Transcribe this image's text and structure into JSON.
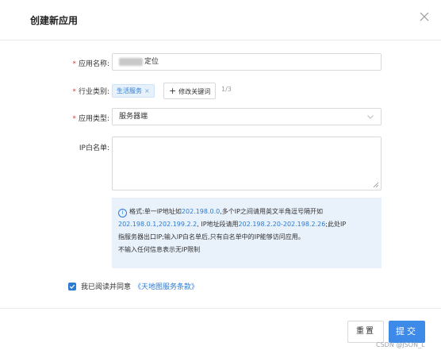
{
  "dialog": {
    "title": "创建新应用",
    "close_icon": "close-icon"
  },
  "form": {
    "app_name": {
      "label": "应用名称:",
      "value": "定位",
      "blurred_prefix": true
    },
    "industry": {
      "label": "行业类别:",
      "tag": "生活服务",
      "tag_remove": "×",
      "edit_button": "修改关键词",
      "edit_icon": "+",
      "count": "1/3"
    },
    "app_type": {
      "label": "应用类型:",
      "value": "服务器端",
      "chevron_icon": "chevron-down-icon"
    },
    "ip_whitelist": {
      "label": "IP白名单:",
      "value": ""
    },
    "hint": {
      "icon": "i",
      "line1_a": "格式:单一IP地址如",
      "line1_ip": "202.198.0.0",
      "line1_b": ",多个IP之间请用英文半角逗号隔开如",
      "line2_ip": "202.198.0.1,202.199.2.2",
      "line2_b": ", IP地址段请用",
      "line2_ip2": "202.198.2.20-202.198.2.26",
      "line2_c": ";此处IP",
      "line3": "指服务器出口IP;输入IP白名单后,只有白名单中的IP能够访问应用。",
      "line4": "不输入任何信息表示无IP限制"
    }
  },
  "agreement": {
    "checked": true,
    "text": "我已阅读并同意",
    "link": "《天地图服务条款》"
  },
  "footer": {
    "reset": "重置",
    "submit": "提交"
  },
  "watermark": "CSDN @JSON_L",
  "colors": {
    "primary": "#3d8ae8",
    "link": "#2b7bd4",
    "required": "#e4393c",
    "hint_bg": "#e9f1fb"
  }
}
